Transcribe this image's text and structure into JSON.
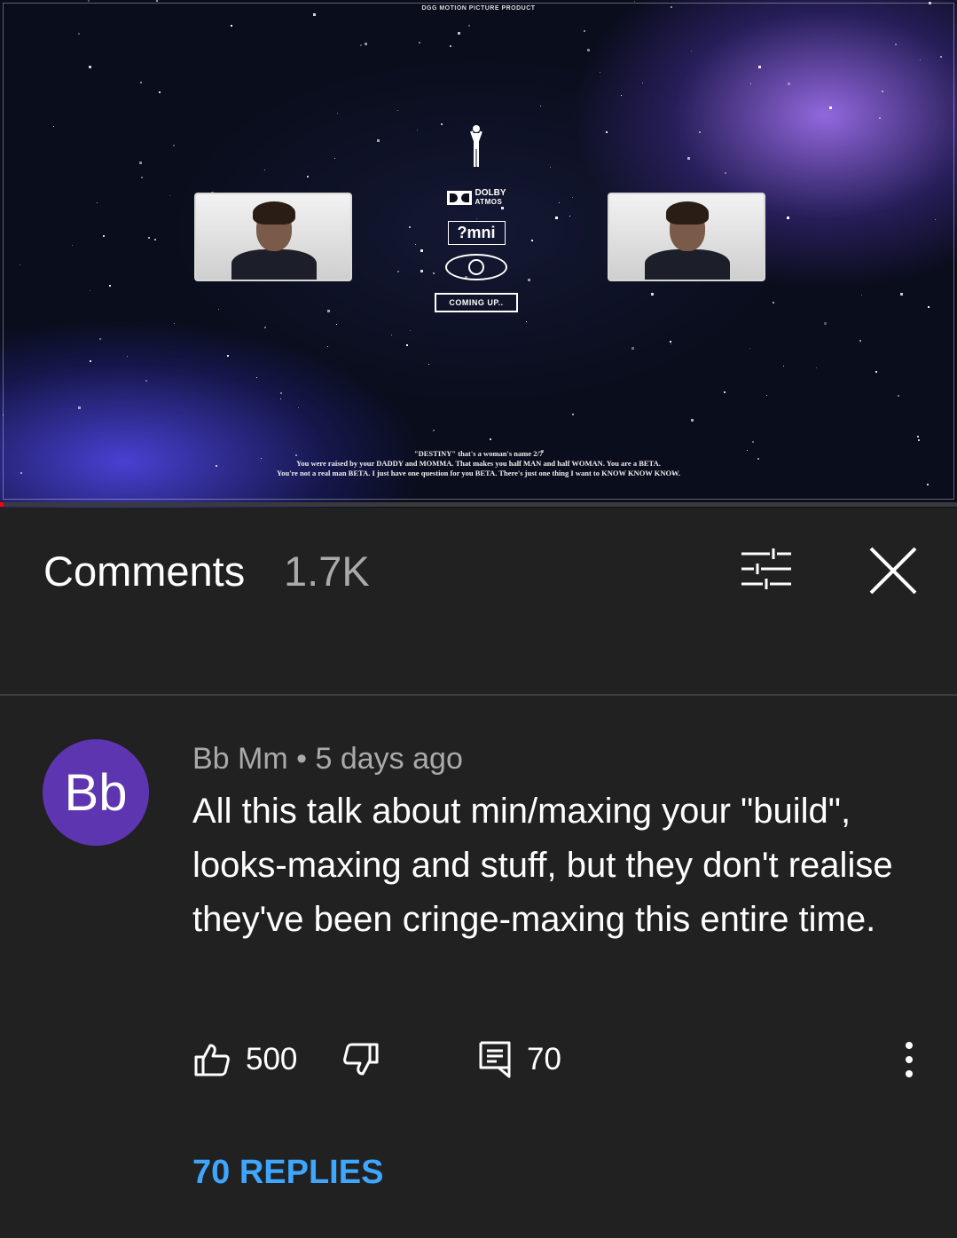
{
  "video": {
    "top_credit": "DGG MOTION PICTURE PRODUCT",
    "dolby_line1": "DOLBY",
    "dolby_line2": "ATMOS",
    "omni_logo": "?mni",
    "coming_up": "COMING UP..",
    "subtitle_line1": "\"DESTINY\" that's a woman's name 2/7",
    "subtitle_line2": "You were raised by your DADDY and MOMMA. That makes you half MAN and half WOMAN. You are a BETA.",
    "subtitle_line3": "You're not a real man BETA. I just have one question for you BETA. There's just one thing I want to KNOW KNOW KNOW.",
    "progress_fraction": 0.004
  },
  "comments_panel": {
    "title": "Comments",
    "count": "1.7K",
    "sort_icon": "sort-sliders-icon",
    "close_icon": "close-icon"
  },
  "comment": {
    "avatar_initials": "Bb",
    "avatar_color": "#5e35b1",
    "author": "Bb Mm",
    "separator": "•",
    "time": "5 days ago",
    "text": "All this talk about min/maxing your \"build\", looks-maxing and stuff, but they don't realise they've been cringe-maxing this entire time.",
    "likes": "500",
    "replies_count": "70",
    "replies_link": "70 REPLIES",
    "link_color": "#3ea6ff"
  }
}
